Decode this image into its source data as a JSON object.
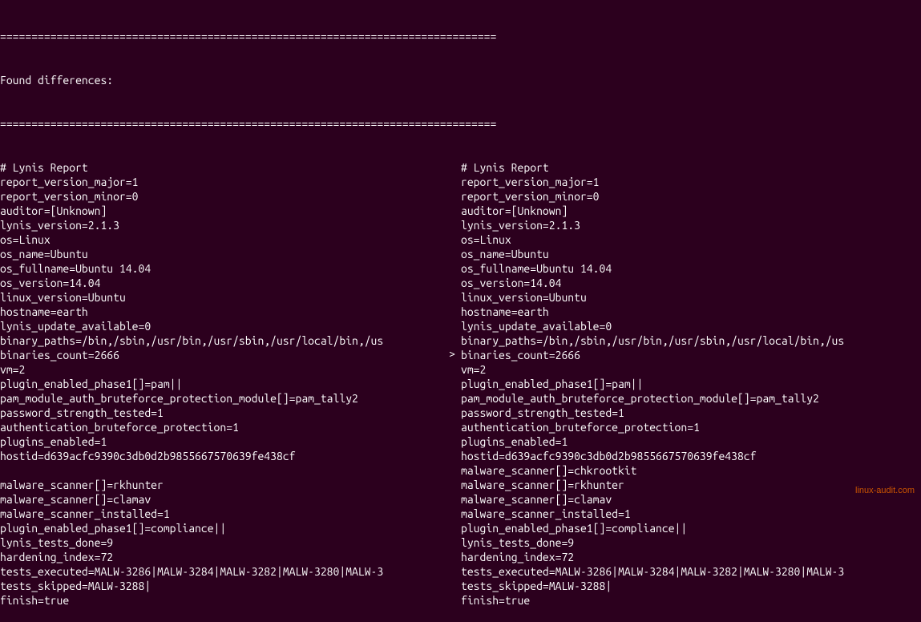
{
  "separator": "===============================================================================",
  "header": "Found differences:",
  "diff_marker": ">",
  "diff_line_index": 20,
  "left_column": [
    "# Lynis Report",
    "report_version_major=1",
    "report_version_minor=0",
    "auditor=[Unknown]",
    "lynis_version=2.1.3",
    "os=Linux",
    "os_name=Ubuntu",
    "os_fullname=Ubuntu 14.04",
    "os_version=14.04",
    "linux_version=Ubuntu",
    "hostname=earth",
    "lynis_update_available=0",
    "binary_paths=/bin,/sbin,/usr/bin,/usr/sbin,/usr/local/bin,/us",
    "binaries_count=2666",
    "vm=2",
    "plugin_enabled_phase1[]=pam||",
    "pam_module_auth_bruteforce_protection_module[]=pam_tally2",
    "password_strength_tested=1",
    "authentication_bruteforce_protection=1",
    "plugins_enabled=1",
    "hostid=d639acfc9390c3db0d2b9855667570639fe438cf",
    "",
    "malware_scanner[]=rkhunter",
    "malware_scanner[]=clamav",
    "malware_scanner_installed=1",
    "plugin_enabled_phase1[]=compliance||",
    "lynis_tests_done=9",
    "hardening_index=72",
    "tests_executed=MALW-3286|MALW-3284|MALW-3282|MALW-3280|MALW-3",
    "tests_skipped=MALW-3288|",
    "finish=true"
  ],
  "right_column": [
    "# Lynis Report",
    "report_version_major=1",
    "report_version_minor=0",
    "auditor=[Unknown]",
    "lynis_version=2.1.3",
    "os=Linux",
    "os_name=Ubuntu",
    "os_fullname=Ubuntu 14.04",
    "os_version=14.04",
    "linux_version=Ubuntu",
    "hostname=earth",
    "lynis_update_available=0",
    "binary_paths=/bin,/sbin,/usr/bin,/usr/sbin,/usr/local/bin,/us",
    "binaries_count=2666",
    "vm=2",
    "plugin_enabled_phase1[]=pam||",
    "pam_module_auth_bruteforce_protection_module[]=pam_tally2",
    "password_strength_tested=1",
    "authentication_bruteforce_protection=1",
    "plugins_enabled=1",
    "hostid=d639acfc9390c3db0d2b9855667570639fe438cf",
    "malware_scanner[]=chkrootkit",
    "malware_scanner[]=rkhunter",
    "malware_scanner[]=clamav",
    "malware_scanner_installed=1",
    "plugin_enabled_phase1[]=compliance||",
    "lynis_tests_done=9",
    "hardening_index=72",
    "tests_executed=MALW-3286|MALW-3284|MALW-3282|MALW-3280|MALW-3",
    "tests_skipped=MALW-3288|",
    "finish=true"
  ],
  "watermark": "linux-audit.com"
}
